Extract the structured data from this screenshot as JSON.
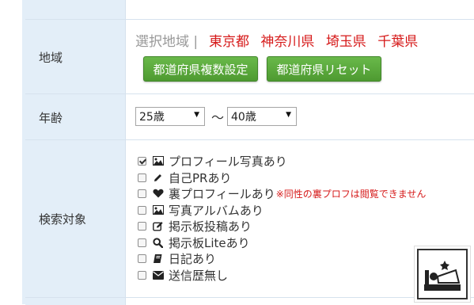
{
  "region": {
    "label": "地域",
    "selected_label": "選択地域 |",
    "selected_items": [
      "東京都",
      "神奈川県",
      "埼玉県",
      "千葉県"
    ],
    "multi_button": "都道府県複数設定",
    "reset_button": "都道府県リセット"
  },
  "age": {
    "label": "年齢",
    "from_value": "25歳",
    "separator": "〜",
    "to_value": "40歳"
  },
  "search_target": {
    "label": "検索対象",
    "options": [
      {
        "text": "プロフィール写真あり",
        "checked": true,
        "icon": "image-icon",
        "note": ""
      },
      {
        "text": "自己PRあり",
        "checked": false,
        "icon": "pencil-icon",
        "note": ""
      },
      {
        "text": "裏プロフィールあり",
        "checked": false,
        "icon": "heart-icon",
        "note": "※同性の裏プロフは閲覧できません"
      },
      {
        "text": "写真アルバムあり",
        "checked": false,
        "icon": "image-icon",
        "note": ""
      },
      {
        "text": "掲示板投稿あり",
        "checked": false,
        "icon": "edit-icon",
        "note": ""
      },
      {
        "text": "掲示板Liteあり",
        "checked": false,
        "icon": "search-icon",
        "note": ""
      },
      {
        "text": "日記あり",
        "checked": false,
        "icon": "book-icon",
        "note": ""
      },
      {
        "text": "送信歴無し",
        "checked": false,
        "icon": "envelope-icon",
        "note": ""
      }
    ]
  },
  "colors": {
    "label_bg": "#e3eef8",
    "accent_red": "#d61a1a",
    "button_green": "#5aa83c"
  }
}
